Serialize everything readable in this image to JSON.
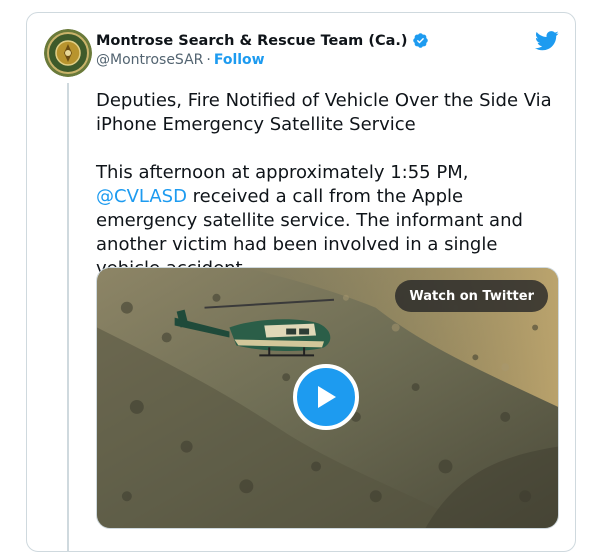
{
  "author": {
    "display_name": "Montrose Search & Rescue Team (Ca.)",
    "handle": "@MontroseSAR",
    "separator": "·",
    "follow_label": "Follow",
    "verified": true
  },
  "tweet": {
    "headline": "Deputies, Fire Notified of Vehicle Over the Side Via iPhone Emergency Satellite Service",
    "body_before_mention": "This afternoon at approximately 1:55 PM, ",
    "mention": "@CVLASD",
    "body_after_mention": " received a call from the Apple emergency satellite service. The informant and another victim had been involved in a single vehicle accident"
  },
  "media": {
    "watch_label": "Watch on Twitter"
  },
  "icons": {
    "brand": "twitter-bird-icon",
    "verified": "verified-badge-icon",
    "play": "play-icon"
  },
  "colors": {
    "accent": "#1d9bf0",
    "text": "#0f1419",
    "secondary_text": "#536471",
    "border": "#cfd9de"
  }
}
